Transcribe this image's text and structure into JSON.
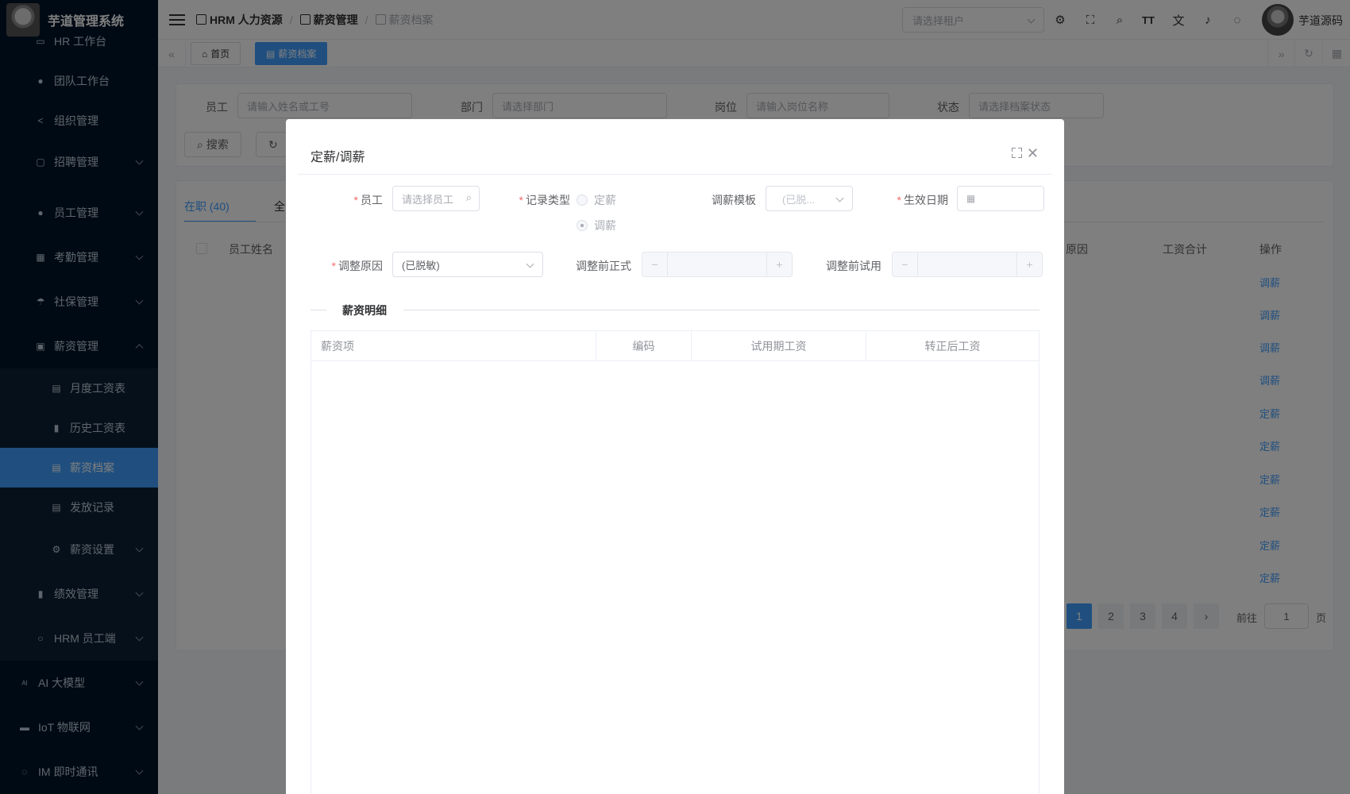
{
  "app": {
    "name": "芋道管理系统",
    "user": "芋道源码"
  },
  "sidebar": {
    "items": [
      {
        "label": "HR 工作台",
        "icon": "monitor-icon"
      },
      {
        "label": "团队工作台",
        "icon": "user-icon"
      },
      {
        "label": "组织管理",
        "icon": "share-icon"
      },
      {
        "label": "招聘管理",
        "icon": "briefcase-icon"
      },
      {
        "label": "员工管理",
        "icon": "user-icon"
      },
      {
        "label": "考勤管理",
        "icon": "calendar-icon"
      },
      {
        "label": "社保管理",
        "icon": "umbrella-icon"
      },
      {
        "label": "薪资管理",
        "icon": "wallet-icon"
      },
      {
        "label": "月度工资表",
        "icon": "document-icon"
      },
      {
        "label": "历史工资表",
        "icon": "bar-chart-icon"
      },
      {
        "label": "薪资档案",
        "icon": "archive-icon"
      },
      {
        "label": "发放记录",
        "icon": "list-icon"
      },
      {
        "label": "薪资设置",
        "icon": "gear-icon"
      },
      {
        "label": "绩效管理",
        "icon": "bar-chart-icon"
      },
      {
        "label": "HRM 员工端",
        "icon": "user-icon"
      },
      {
        "label": "AI 大模型",
        "icon": "ai-icon"
      },
      {
        "label": "IoT 物联网",
        "icon": "router-icon"
      },
      {
        "label": "IM 即时通讯",
        "icon": "chat-icon"
      }
    ]
  },
  "header": {
    "breadcrumb": [
      "HRM 人力资源",
      "薪资管理",
      "薪资档案"
    ],
    "tenant_placeholder": "请选择租户"
  },
  "tags": {
    "home": "首页",
    "current": "薪资档案"
  },
  "search": {
    "employee_label": "员工",
    "employee_placeholder": "请输入姓名或工号",
    "dept_label": "部门",
    "dept_placeholder": "请选择部门",
    "post_label": "岗位",
    "post_placeholder": "请输入岗位名称",
    "status_label": "状态",
    "status_placeholder": "请选择档案状态",
    "search_button": "搜索"
  },
  "list": {
    "tab_active": "在职 (40)",
    "tab_all": "全",
    "columns": {
      "name": "员工姓名",
      "reason": "原因",
      "total": "工资合计",
      "ops": "操作"
    },
    "row_actions": [
      "调薪",
      "调薪",
      "调薪",
      "调薪",
      "定薪",
      "定薪",
      "定薪",
      "定薪",
      "定薪",
      "定薪"
    ],
    "pagination": {
      "pages": [
        "1",
        "2",
        "3",
        "4"
      ],
      "current": "1",
      "goto_label": "前往",
      "goto_value": "1",
      "page_suffix": "页"
    }
  },
  "dialog": {
    "title": "定薪/调薪",
    "employee_label": "员工",
    "employee_placeholder": "请选择员工",
    "record_type_label": "记录类型",
    "record_type_options": [
      "定薪",
      "调薪"
    ],
    "record_type_selected": "调薪",
    "template_label": "调薪模板",
    "template_value": "(已脱...",
    "effective_date_label": "生效日期",
    "reason_label": "调整原因",
    "reason_value": "(已脱敏)",
    "before_regular_label": "调整前正式",
    "before_probation_label": "调整前试用",
    "section_title": "薪资明细",
    "table_columns": [
      "薪资项",
      "编码",
      "试用期工资",
      "转正后工资"
    ]
  }
}
